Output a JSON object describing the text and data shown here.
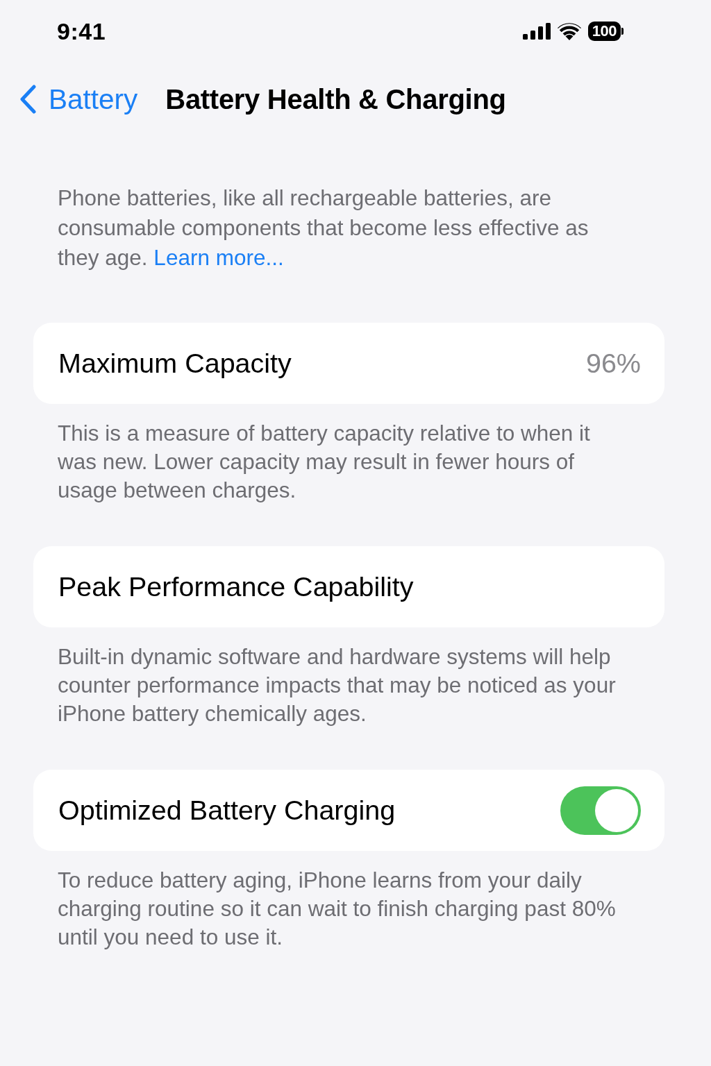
{
  "status_bar": {
    "time": "9:41",
    "battery": "100"
  },
  "nav": {
    "back": "Battery",
    "title": "Battery Health & Charging"
  },
  "intro": {
    "text": "Phone batteries, like all rechargeable batteries, are consumable components that become less effective as they age.",
    "link": "Learn more..."
  },
  "sections": [
    {
      "kind": "value",
      "label": "Maximum Capacity",
      "value": "96%",
      "footer": "This is a measure of battery capacity relative to when it was new. Lower capacity may result in fewer hours of usage between charges."
    },
    {
      "kind": "plain",
      "label": "Peak Performance Capability",
      "footer": "Built-in dynamic software and hardware systems will help counter performance impacts that may be noticed as your iPhone battery chemically ages."
    },
    {
      "kind": "toggle",
      "label": "Optimized Battery Charging",
      "on": true,
      "footer": "To reduce battery aging, iPhone learns from your daily charging routine so it can wait to finish charging past 80% until you need to use it."
    }
  ]
}
